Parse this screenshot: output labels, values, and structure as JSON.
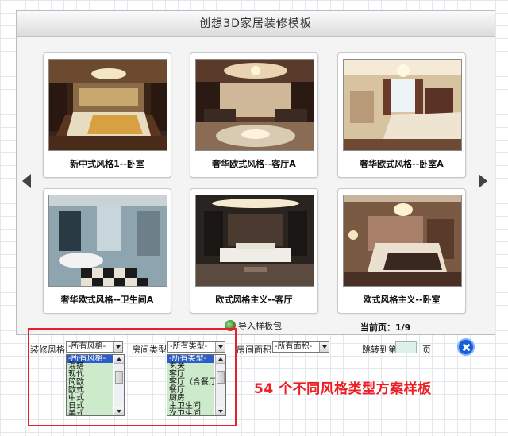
{
  "window": {
    "title": "创想3D家居装修模板"
  },
  "nav": {
    "prev": "left-arrow-icon",
    "next": "right-arrow-icon"
  },
  "templates": [
    {
      "caption": "新中式风格1--卧室"
    },
    {
      "caption": "奢华欧式风格--客厅A"
    },
    {
      "caption": "奢华欧式风格--卧室A"
    },
    {
      "caption": "奢华欧式风格--卫生间A"
    },
    {
      "caption": "欧式风格主义--客厅"
    },
    {
      "caption": "欧式风格主义--卧室"
    }
  ],
  "actions": {
    "import_label": "导入样板包"
  },
  "pagination": {
    "label": "当前页：",
    "value": "1/9"
  },
  "filters": {
    "style_label": "装修风格",
    "style_value": "-所有风格-",
    "room_type_label": "房间类型",
    "room_type_value": "-所有类型-",
    "area_label": "房间面积",
    "area_value": "-所有面积-",
    "jump_label": "跳转到第",
    "jump_value": "",
    "page_unit": "页"
  },
  "style_options": [
    "-所有风格-",
    "混搭",
    "现代",
    "简欧",
    "欧式",
    "中式",
    "日式",
    "美式"
  ],
  "room_type_options": [
    "-所有类型-",
    "玄关",
    "客厅",
    "客厅（含餐厅",
    "餐厅",
    "厨房",
    "主卫生间",
    "次卫生间"
  ],
  "promo_text": "54 个不同风格类型方案样板",
  "colors": {
    "accent_red": "#ee1d24",
    "list_bg": "#cdeacb",
    "list_selected": "#2b5fc7",
    "close_blue": "#1a5fd1"
  }
}
